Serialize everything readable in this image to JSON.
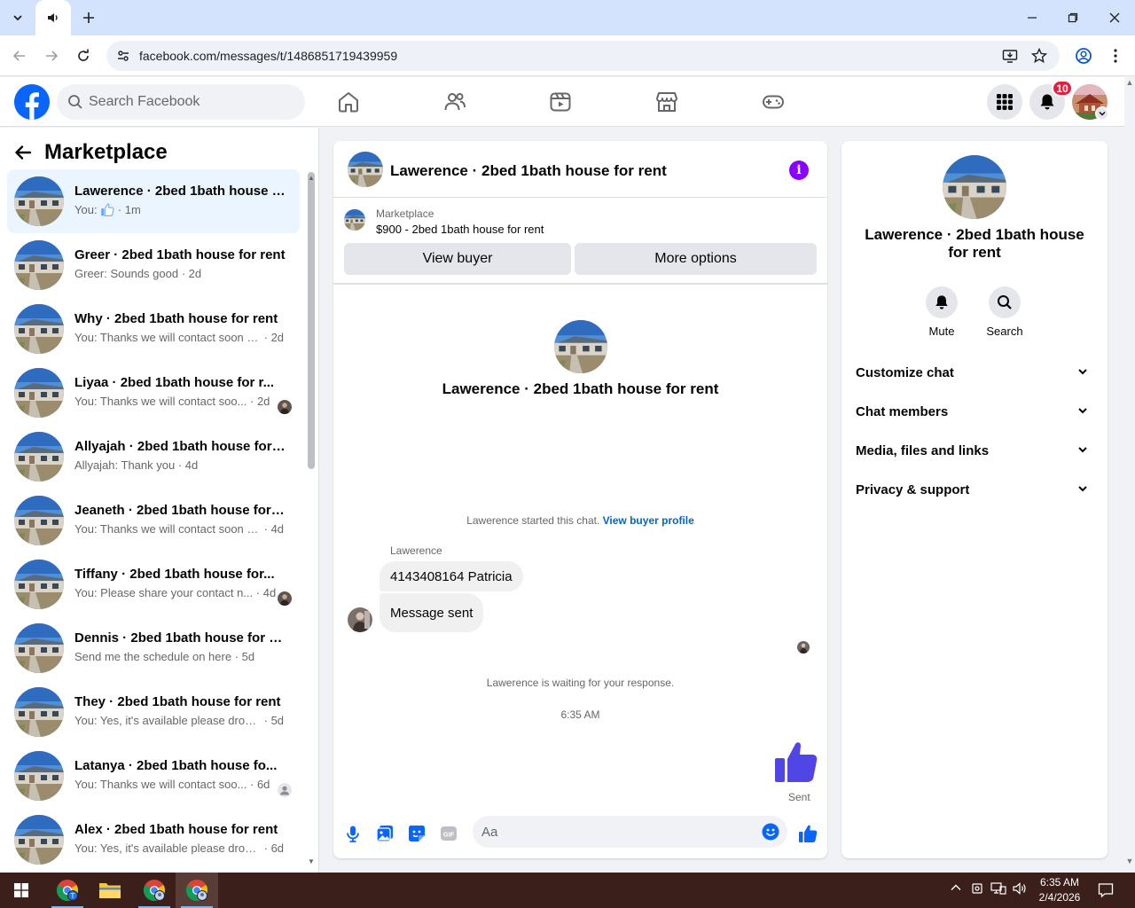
{
  "browser": {
    "url": "facebook.com/messages/t/1486851719439959"
  },
  "header": {
    "search_placeholder": "Search Facebook",
    "notification_count": "10"
  },
  "sidebar": {
    "title": "Marketplace",
    "conversations": [
      {
        "name": "Lawerence",
        "listing": "2bed 1bath house f...",
        "preview_prefix": "You: ",
        "preview": "",
        "time": "1m",
        "like": true,
        "active": true,
        "seen": ""
      },
      {
        "name": "Greer",
        "listing": "2bed 1bath house for rent",
        "preview_prefix": "",
        "preview": "Greer: Sounds good",
        "time": "2d",
        "like": false,
        "active": false,
        "seen": ""
      },
      {
        "name": "Why",
        "listing": "2bed 1bath house for rent",
        "preview_prefix": "",
        "preview": "You: Thanks we will contact soon w...",
        "time": "2d",
        "like": false,
        "active": false,
        "seen": ""
      },
      {
        "name": "Liyaa",
        "listing": "2bed 1bath house for r...",
        "preview_prefix": "",
        "preview": "You: Thanks we will contact soo...",
        "time": "2d",
        "like": false,
        "active": false,
        "seen": "photo"
      },
      {
        "name": "Allyajah",
        "listing": "2bed 1bath house for r...",
        "preview_prefix": "",
        "preview": "Allyajah: Thank you",
        "time": "4d",
        "like": false,
        "active": false,
        "seen": ""
      },
      {
        "name": "Jeaneth",
        "listing": "2bed 1bath house for r...",
        "preview_prefix": "",
        "preview": "You: Thanks we will contact soon w...",
        "time": "4d",
        "like": false,
        "active": false,
        "seen": ""
      },
      {
        "name": "Tiffany",
        "listing": "2bed 1bath house for...",
        "preview_prefix": "",
        "preview": "You: Please share your contact n...",
        "time": "4d",
        "like": false,
        "active": false,
        "seen": "photo"
      },
      {
        "name": "Dennis",
        "listing": "2bed 1bath house for re...",
        "preview_prefix": "",
        "preview": "Send me the schedule on here",
        "time": "5d",
        "like": false,
        "active": false,
        "seen": ""
      },
      {
        "name": "They",
        "listing": "2bed 1bath house for rent",
        "preview_prefix": "",
        "preview": "You: Yes, it's available please drop y...",
        "time": "5d",
        "like": false,
        "active": false,
        "seen": ""
      },
      {
        "name": "Latanya",
        "listing": "2bed 1bath house fo...",
        "preview_prefix": "",
        "preview": "You: Thanks we will contact soo...",
        "time": "6d",
        "like": false,
        "active": false,
        "seen": "default"
      },
      {
        "name": "Alex",
        "listing": "2bed 1bath house for rent",
        "preview_prefix": "",
        "preview": "You: Yes, it's available please drop y...",
        "time": "6d",
        "like": false,
        "active": false,
        "seen": ""
      }
    ]
  },
  "chat": {
    "title": "Lawerence · 2bed 1bath house for rent",
    "listing_source": "Marketplace",
    "listing_title": "$900 - 2bed 1bath house for rent",
    "view_buyer_label": "View buyer",
    "more_options_label": "More options",
    "intro_title": "Lawerence · 2bed 1bath house for rent",
    "started_text": "Lawerence started this chat.",
    "view_buyer_profile": "View buyer profile",
    "sender_name": "Lawerence",
    "messages": [
      "4143408164 Patricia",
      "Message sent"
    ],
    "waiting_text": "Lawerence is waiting for your response.",
    "timestamp": "6:35 AM",
    "sent_label": "Sent",
    "composer_placeholder": "Aa"
  },
  "info": {
    "title": "Lawerence · 2bed 1bath house for rent",
    "mute_label": "Mute",
    "search_label": "Search",
    "sections": [
      "Customize chat",
      "Chat members",
      "Media, files and links",
      "Privacy & support"
    ]
  },
  "taskbar": {
    "time": "6:35 AM",
    "date": "2/4/2026"
  },
  "colors": {
    "facebook_blue": "#0866ff",
    "messenger_like": "#4f46e5",
    "active_conv_bg": "#ebf5ff",
    "info_purple": "#8a00ff",
    "badge_red": "#e41e3f"
  }
}
